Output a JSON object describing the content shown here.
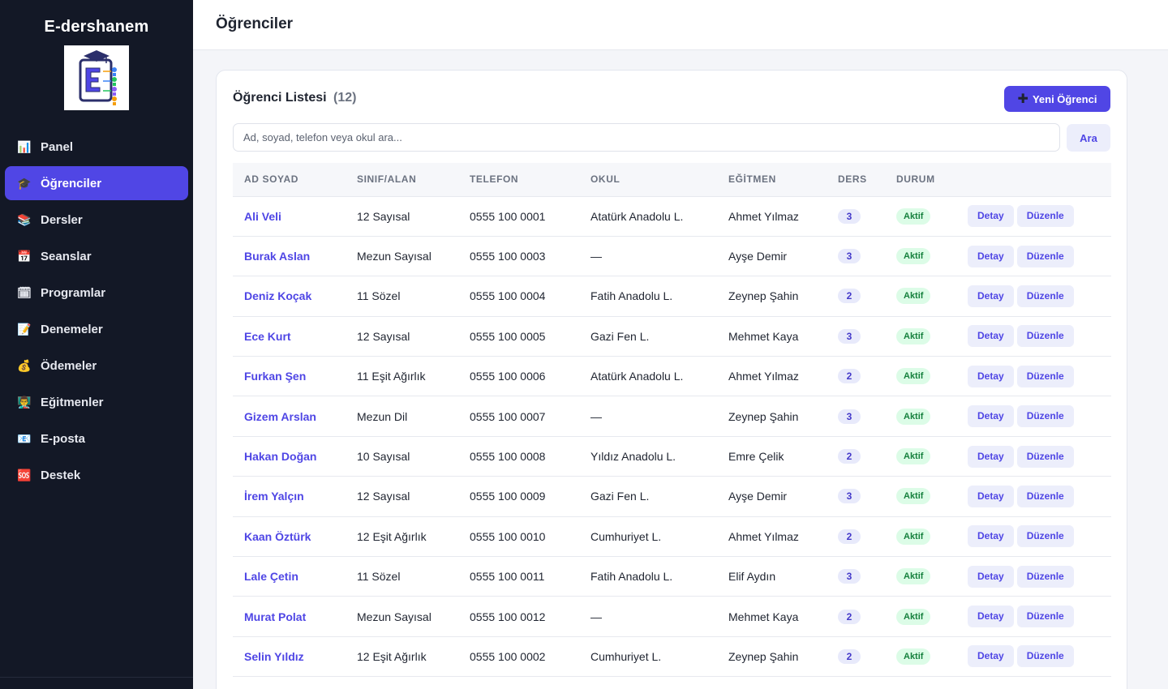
{
  "sidebar": {
    "brand": "E-dershanem",
    "logo_icon": "e-dershanem-logo",
    "items": [
      {
        "label": "Panel",
        "icon": "📊"
      },
      {
        "label": "Öğrenciler",
        "icon": "🎓",
        "active": true
      },
      {
        "label": "Dersler",
        "icon": "📚"
      },
      {
        "label": "Seanslar",
        "icon": "📅"
      },
      {
        "label": "Programlar",
        "icon": "🗓"
      },
      {
        "label": "Denemeler",
        "icon": "📝"
      },
      {
        "label": "Ödemeler",
        "icon": "💰"
      },
      {
        "label": "Eğitmenler",
        "icon": "👨‍🏫"
      },
      {
        "label": "E-posta",
        "icon": "📧"
      },
      {
        "label": "Destek",
        "icon": "🆘"
      }
    ]
  },
  "header": {
    "title": "Öğrenciler"
  },
  "card": {
    "title": "Öğrenci Listesi",
    "count": "(12)",
    "new_button": "Yeni Öğrenci",
    "search_placeholder": "Ad, soyad, telefon veya okul ara...",
    "search_button": "Ara"
  },
  "table": {
    "columns": [
      "AD SOYAD",
      "SINIF/ALAN",
      "TELEFON",
      "OKUL",
      "EĞİTMEN",
      "DERS",
      "DURUM",
      ""
    ],
    "detail_label": "Detay",
    "edit_label": "Düzenle",
    "rows": [
      {
        "name": "Ali Veli",
        "class": "12 Sayısal",
        "phone": "0555 100 0001",
        "school": "Atatürk Anadolu L.",
        "teacher": "Ahmet Yılmaz",
        "lessons": "3",
        "status": "Aktif"
      },
      {
        "name": "Burak Aslan",
        "class": "Mezun Sayısal",
        "phone": "0555 100 0003",
        "school": "—",
        "teacher": "Ayşe Demir",
        "lessons": "3",
        "status": "Aktif"
      },
      {
        "name": "Deniz Koçak",
        "class": "11 Sözel",
        "phone": "0555 100 0004",
        "school": "Fatih Anadolu L.",
        "teacher": "Zeynep Şahin",
        "lessons": "2",
        "status": "Aktif"
      },
      {
        "name": "Ece Kurt",
        "class": "12 Sayısal",
        "phone": "0555 100 0005",
        "school": "Gazi Fen L.",
        "teacher": "Mehmet Kaya",
        "lessons": "3",
        "status": "Aktif"
      },
      {
        "name": "Furkan Şen",
        "class": "11 Eşit Ağırlık",
        "phone": "0555 100 0006",
        "school": "Atatürk Anadolu L.",
        "teacher": "Ahmet Yılmaz",
        "lessons": "2",
        "status": "Aktif"
      },
      {
        "name": "Gizem Arslan",
        "class": "Mezun Dil",
        "phone": "0555 100 0007",
        "school": "—",
        "teacher": "Zeynep Şahin",
        "lessons": "3",
        "status": "Aktif"
      },
      {
        "name": "Hakan Doğan",
        "class": "10 Sayısal",
        "phone": "0555 100 0008",
        "school": "Yıldız Anadolu L.",
        "teacher": "Emre Çelik",
        "lessons": "2",
        "status": "Aktif"
      },
      {
        "name": "İrem Yalçın",
        "class": "12 Sayısal",
        "phone": "0555 100 0009",
        "school": "Gazi Fen L.",
        "teacher": "Ayşe Demir",
        "lessons": "3",
        "status": "Aktif"
      },
      {
        "name": "Kaan Öztürk",
        "class": "12 Eşit Ağırlık",
        "phone": "0555 100 0010",
        "school": "Cumhuriyet L.",
        "teacher": "Ahmet Yılmaz",
        "lessons": "2",
        "status": "Aktif"
      },
      {
        "name": "Lale Çetin",
        "class": "11 Sözel",
        "phone": "0555 100 0011",
        "school": "Fatih Anadolu L.",
        "teacher": "Elif Aydın",
        "lessons": "3",
        "status": "Aktif"
      },
      {
        "name": "Murat Polat",
        "class": "Mezun Sayısal",
        "phone": "0555 100 0012",
        "school": "—",
        "teacher": "Mehmet Kaya",
        "lessons": "2",
        "status": "Aktif"
      },
      {
        "name": "Selin Yıldız",
        "class": "12 Eşit Ağırlık",
        "phone": "0555 100 0002",
        "school": "Cumhuriyet L.",
        "teacher": "Zeynep Şahin",
        "lessons": "2",
        "status": "Aktif"
      }
    ]
  }
}
